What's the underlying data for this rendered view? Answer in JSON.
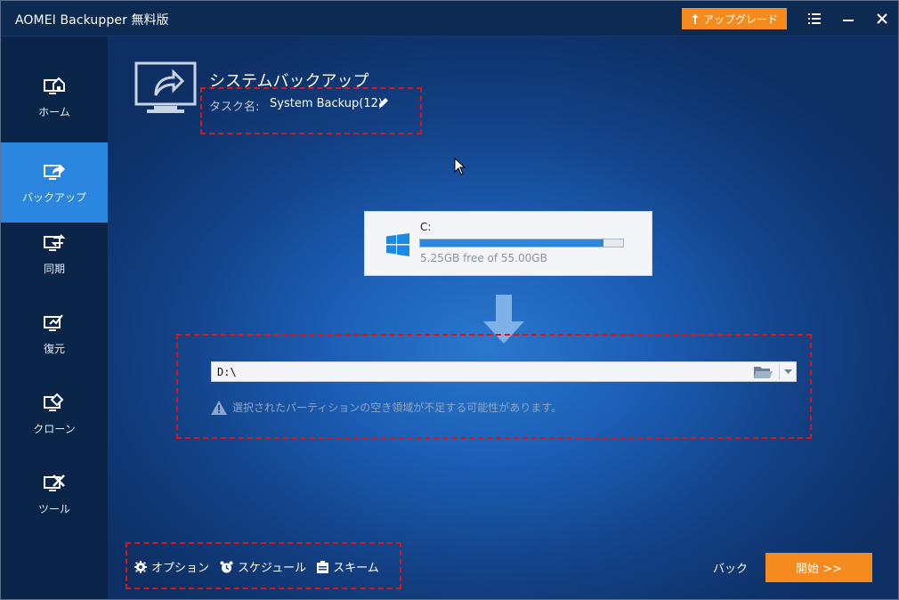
{
  "window": {
    "title": "AOMEI Backupper 無料版"
  },
  "titlebar": {
    "upgrade_label": "アップグレード",
    "upgrade_icon": "upgrade-arrow-icon",
    "menu_icon": "menu-icon",
    "minimize_icon": "minimize-icon",
    "close_icon": "close-icon"
  },
  "sidebar": {
    "items": [
      {
        "label": "ホーム",
        "icon": "home-icon",
        "active": false
      },
      {
        "label": "バックアップ",
        "icon": "backup-icon",
        "active": true
      },
      {
        "label": "同期",
        "icon": "sync-icon",
        "active": false
      },
      {
        "label": "復元",
        "icon": "restore-icon",
        "active": false
      },
      {
        "label": "クローン",
        "icon": "clone-icon",
        "active": false
      },
      {
        "label": "ツール",
        "icon": "tools-icon",
        "active": false
      }
    ]
  },
  "main": {
    "title": "システムバックアップ",
    "task_name_label": "タスク名:",
    "task_name_value": "System Backup(12)",
    "source": {
      "drive": "C:",
      "free_text": "5.25GB free of 55.00GB",
      "used_fraction": 0.905
    },
    "destination": {
      "path": "D:\\",
      "warning": "選択されたパーティションの空き領域が不足する可能性があります。"
    }
  },
  "footer": {
    "options_label": "オプション",
    "schedule_label": "スケジュール",
    "scheme_label": "スキーム",
    "back_label": "バック",
    "start_label": "開始 >>"
  },
  "colors": {
    "accent_orange": "#f58a1e",
    "sidebar_active": "#2b86e0",
    "annotation_red": "#d81818"
  }
}
